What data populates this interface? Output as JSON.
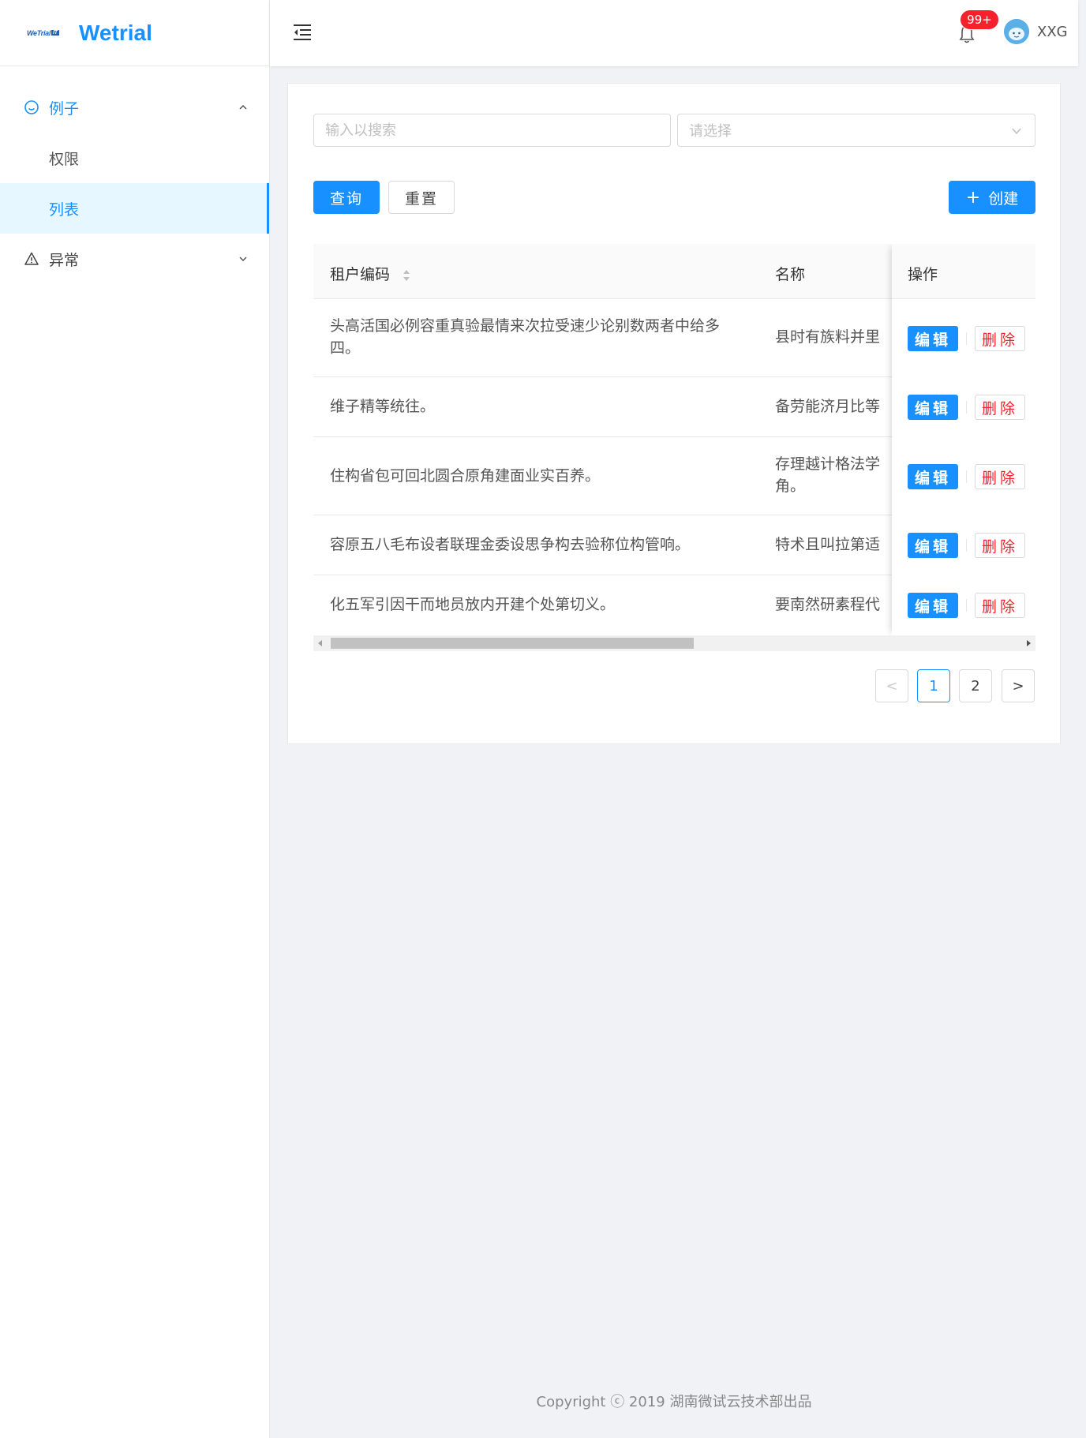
{
  "app": {
    "title": "Wetrial",
    "logo_text": "WeTrial",
    "logo_box_text": "IT"
  },
  "sidebar": {
    "items": [
      {
        "label": "例子",
        "icon": "smile-icon",
        "expanded": true
      },
      {
        "label": "权限"
      },
      {
        "label": "列表",
        "selected": true
      },
      {
        "label": "异常",
        "icon": "warning-icon",
        "expanded": false
      }
    ]
  },
  "header": {
    "notification_count": "99+",
    "user_name": "XXG"
  },
  "filters": {
    "search_placeholder": "输入以搜索",
    "select_placeholder": "请选择",
    "query_label": "查询",
    "reset_label": "重置",
    "create_label": "创建"
  },
  "table": {
    "columns": [
      "租户编码",
      "名称",
      "操作"
    ],
    "rows": [
      {
        "code": "头高活国必例容重真验最情来次拉受速少论别数两者中给多四。",
        "name": "县时有族料并里"
      },
      {
        "code": "维子精等统往。",
        "name": "备劳能济月比等"
      },
      {
        "code": "住构省包可回北圆合原角建面业实百养。",
        "name": "存理越计格法学角。"
      },
      {
        "code": "容原五八毛布设者联理金委设思争构去验称位构管响。",
        "name": "特术且叫拉第适"
      },
      {
        "code": "化五军引因干而地员放内开建个处第切义。",
        "name": "要南然研素程代"
      }
    ],
    "edit_label": "编辑",
    "delete_label": "删除"
  },
  "pagination": {
    "pages": [
      "1",
      "2"
    ],
    "current": "1",
    "prev": "<",
    "next": ">"
  },
  "footer": {
    "text": "Copyright ⓒ 2019 湖南微试云技术部出品"
  },
  "colors": {
    "primary": "#1890ff",
    "danger": "#f5222d",
    "background": "#f0f2f5"
  }
}
